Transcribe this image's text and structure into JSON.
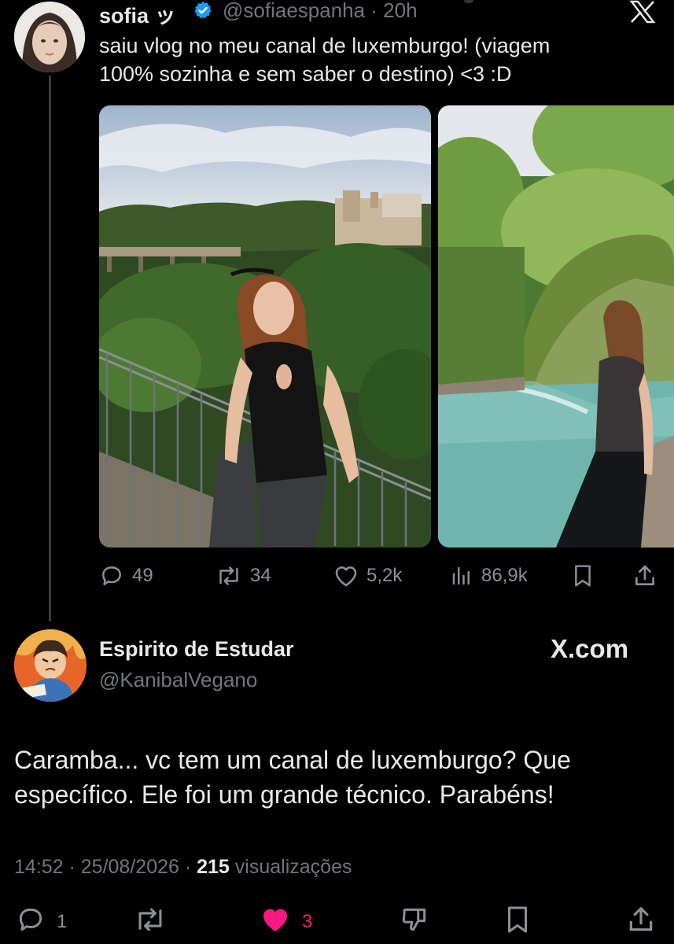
{
  "original_tweet": {
    "display_name": "sofia ッ",
    "handle_time": "@sofiaespanha · 20h",
    "text": "saiu vlog no meu canal de luxemburgo! (viagem\n100% sozinha e sem saber o destino) <3 :D",
    "photos": [
      {
        "icon": "photo-luxembourg-viewpoint"
      },
      {
        "icon": "photo-waterfall-pool"
      }
    ],
    "actions": {
      "replies": "49",
      "reposts": "34",
      "likes": "5,2k",
      "views": "86,9k"
    }
  },
  "reply": {
    "display_name": "Espirito de Estudar",
    "handle": "@KanibalVegano",
    "watermark": "X.com",
    "text": "Caramba... vc tem um canal de luxemburgo? Que específico. Ele foi um grande técnico. Parabéns!",
    "meta": {
      "timestamp": "14:52 · 25/08/2026 ·",
      "views_count": "215",
      "views_label": "visualizações"
    },
    "actions": {
      "replies": "1",
      "likes": "3"
    }
  },
  "colors": {
    "background": "#000000",
    "text": "#e7e9ea",
    "muted": "#71767b",
    "verified": "#1d9bf0",
    "like_active": "#f91880"
  }
}
